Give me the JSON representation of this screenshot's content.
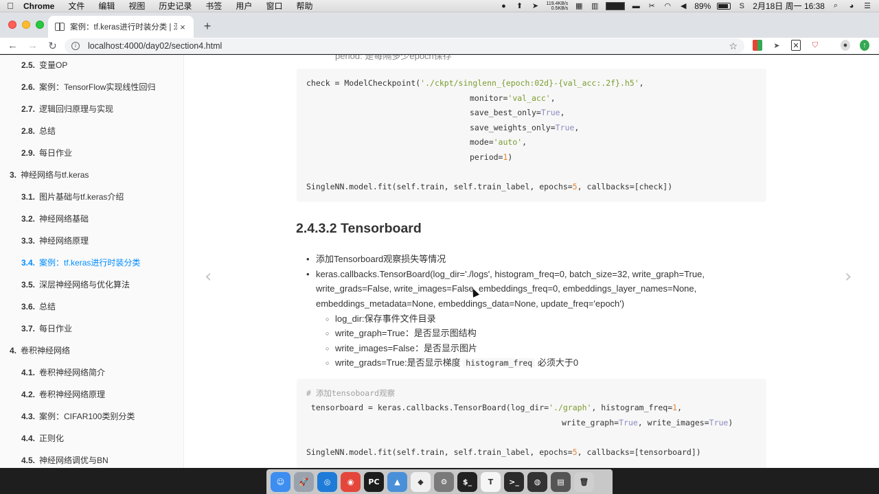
{
  "menubar": {
    "app_name": "Chrome",
    "menus": [
      "文件",
      "编辑",
      "视图",
      "历史记录",
      "书签",
      "用户",
      "窗口",
      "帮助"
    ],
    "net_up": "119.4KB/s",
    "net_down": "0.5KB/s",
    "battery": "89%",
    "datetime": "2月18日 周一  16:38"
  },
  "browser": {
    "tab_title": "案例：tf.keras进行时装分类 | 深",
    "url": "localhost:4000/day02/section4.html",
    "new_tab_glyph": "+",
    "close_glyph": "×"
  },
  "sidebar": {
    "items": [
      {
        "num": "2.5.",
        "label": "变量OP"
      },
      {
        "num": "2.6.",
        "label": "案例：TensorFlow实现线性回归"
      },
      {
        "num": "2.7.",
        "label": "逻辑回归原理与实现"
      },
      {
        "num": "2.8.",
        "label": "总结"
      },
      {
        "num": "2.9.",
        "label": "每日作业"
      },
      {
        "num": "3.",
        "label": "神经网络与tf.keras"
      },
      {
        "num": "3.1.",
        "label": "图片基础与tf.keras介绍"
      },
      {
        "num": "3.2.",
        "label": "神经网络基础"
      },
      {
        "num": "3.3.",
        "label": "神经网络原理"
      },
      {
        "num": "3.4.",
        "label": "案例：tf.keras进行时装分类"
      },
      {
        "num": "3.5.",
        "label": "深层神经网络与优化算法"
      },
      {
        "num": "3.6.",
        "label": "总结"
      },
      {
        "num": "3.7.",
        "label": "每日作业"
      },
      {
        "num": "4.",
        "label": "卷积神经网络"
      },
      {
        "num": "4.1.",
        "label": "卷积神经网络简介"
      },
      {
        "num": "4.2.",
        "label": "卷积神经网络原理"
      },
      {
        "num": "4.3.",
        "label": "案例：CIFAR100类别分类"
      },
      {
        "num": "4.4.",
        "label": "正则化"
      },
      {
        "num": "4.5.",
        "label": "神经网络调优与BN"
      }
    ]
  },
  "content": {
    "partial_top": "period: 是每隔多少epoch保存",
    "code1": {
      "l1a": "check = ModelCheckpoint(",
      "l1b": "'./ckpt/singlenn_{epoch:02d}-{val_acc:.2f}.h5'",
      "l1c": ",",
      "l2a": "monitor=",
      "l2b": "'val_acc'",
      "l2c": ",",
      "l3a": "save_best_only=",
      "l3b": "True",
      "l3c": ",",
      "l4a": "save_weights_only=",
      "l4b": "True",
      "l4c": ",",
      "l5a": "mode=",
      "l5b": "'auto'",
      "l5c": ",",
      "l6a": "period=",
      "l6b": "1",
      "l6c": ")",
      "l7a": "SingleNN.model.fit(self.train, self.train_label, epochs=",
      "l7b": "5",
      "l7c": ", callbacks=[check])"
    },
    "section_title": "2.4.3.2 Tensorboard",
    "bullets": {
      "b1": "添加Tensorboard观察损失等情况",
      "b2_l1": "keras.callbacks.TensorBoard(log_dir='./logs', histogram_freq=0, batch_size=32, write_graph=True,",
      "b2_l2": "write_grads=False, write_images=False, embeddings_freq=0, embeddings_layer_names=None,",
      "b2_l3": "embeddings_metadata=None, embeddings_data=None, update_freq='epoch')",
      "s1": "log_dir:保存事件文件目录",
      "s2": "write_graph=True：是否显示图结构",
      "s3": "write_images=False：是否显示图片",
      "s4a": "write_grads=True:是否显示梯度",
      "s4b": "histogram_freq",
      "s4c": "必须大于0"
    },
    "code2": {
      "comment": "# 添加tensoboard观察",
      "l1a": " tensorboard = keras.callbacks.TensorBoard(log_dir=",
      "l1b": "'./graph'",
      "l1c": ", histogram_freq=",
      "l1d": "1",
      "l1e": ",",
      "l2a": "write_graph=",
      "l2b": "True",
      "l2c": ", write_images=",
      "l2d": "True",
      "l2e": ")",
      "l3a": "SingleNN.model.fit(self.train, self.train_label, epochs=",
      "l3b": "5",
      "l3c": ", callbacks=[tensorboard])"
    },
    "prev_glyph": "‹",
    "next_glyph": "›"
  },
  "dock": {
    "apps": [
      {
        "name": "finder",
        "glyph": "☺",
        "color": "#3d8ef0"
      },
      {
        "name": "launchpad",
        "glyph": "🚀",
        "color": "#9aa3ad"
      },
      {
        "name": "safari",
        "glyph": "◎",
        "color": "#1e7bd8"
      },
      {
        "name": "chrome",
        "glyph": "◉",
        "color": "#e4463b"
      },
      {
        "name": "pycharm",
        "glyph": "PC",
        "color": "#1c1c1c"
      },
      {
        "name": "keynote",
        "glyph": "▲",
        "color": "#4a90d9"
      },
      {
        "name": "brave",
        "glyph": "◆",
        "color": "#f0f0f0"
      },
      {
        "name": "system-preferences",
        "glyph": "⚙",
        "color": "#7a7a7a"
      },
      {
        "name": "terminal",
        "glyph": "$_",
        "color": "#222222"
      },
      {
        "name": "typora",
        "glyph": "T",
        "color": "#f5f5f5"
      },
      {
        "name": "iterm",
        "glyph": ">_",
        "color": "#2b2b2b"
      },
      {
        "name": "obs",
        "glyph": "◍",
        "color": "#333333"
      },
      {
        "name": "virtualbox",
        "glyph": "▤",
        "color": "#555555"
      },
      {
        "name": "trash",
        "glyph": "🗑",
        "color": "#cfcfcf"
      }
    ]
  }
}
